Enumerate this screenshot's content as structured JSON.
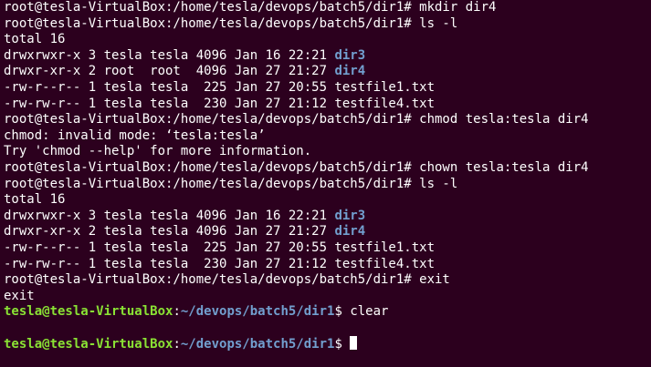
{
  "terminal": {
    "block1": {
      "l01": "root@tesla-VirtualBox:/home/tesla/devops/batch5/dir1# mkdir dir4",
      "l02": "root@tesla-VirtualBox:/home/tesla/devops/batch5/dir1# ls -l",
      "l03": "total 16",
      "l04_meta": "drwxrwxr-x 3 tesla tesla 4096 Jan 16 22:21 ",
      "l04_name": "dir3",
      "l05_meta": "drwxr-xr-x 2 root  root  4096 Jan 27 21:27 ",
      "l05_name": "dir4",
      "l06": "-rw-r--r-- 1 tesla tesla  225 Jan 27 20:55 testfile1.txt",
      "l07": "-rw-rw-r-- 1 tesla tesla  230 Jan 27 21:12 testfile4.txt",
      "l08": "root@tesla-VirtualBox:/home/tesla/devops/batch5/dir1# chmod tesla:tesla dir4",
      "l09": "chmod: invalid mode: ‘tesla:tesla’",
      "l10": "Try 'chmod --help' for more information.",
      "l11": "root@tesla-VirtualBox:/home/tesla/devops/batch5/dir1# chown tesla:tesla dir4",
      "l12": "root@tesla-VirtualBox:/home/tesla/devops/batch5/dir1# ls -l",
      "l13": "total 16",
      "l14_meta": "drwxrwxr-x 3 tesla tesla 4096 Jan 16 22:21 ",
      "l14_name": "dir3",
      "l15_meta": "drwxr-xr-x 2 tesla tesla 4096 Jan 27 21:27 ",
      "l15_name": "dir4",
      "l16": "-rw-r--r-- 1 tesla tesla  225 Jan 27 20:55 testfile1.txt",
      "l17": "-rw-rw-r-- 1 tesla tesla  230 Jan 27 21:12 testfile4.txt",
      "l18": "root@tesla-VirtualBox:/home/tesla/devops/batch5/dir1# exit",
      "l19": "exit"
    },
    "prompt1": {
      "user": "tesla@tesla-VirtualBox",
      "sep": ":",
      "path": "~/devops/batch5/dir1",
      "symbol": "$ ",
      "command": "clear"
    },
    "prompt2": {
      "user": "tesla@tesla-VirtualBox",
      "sep": ":",
      "path": "~/devops/batch5/dir1",
      "symbol": "$ "
    },
    "colors": {
      "background": "#2c001e",
      "text": "#ffffff",
      "directory": "#729fcf",
      "prompt_user": "#8ae234",
      "prompt_path": "#729fcf"
    }
  }
}
